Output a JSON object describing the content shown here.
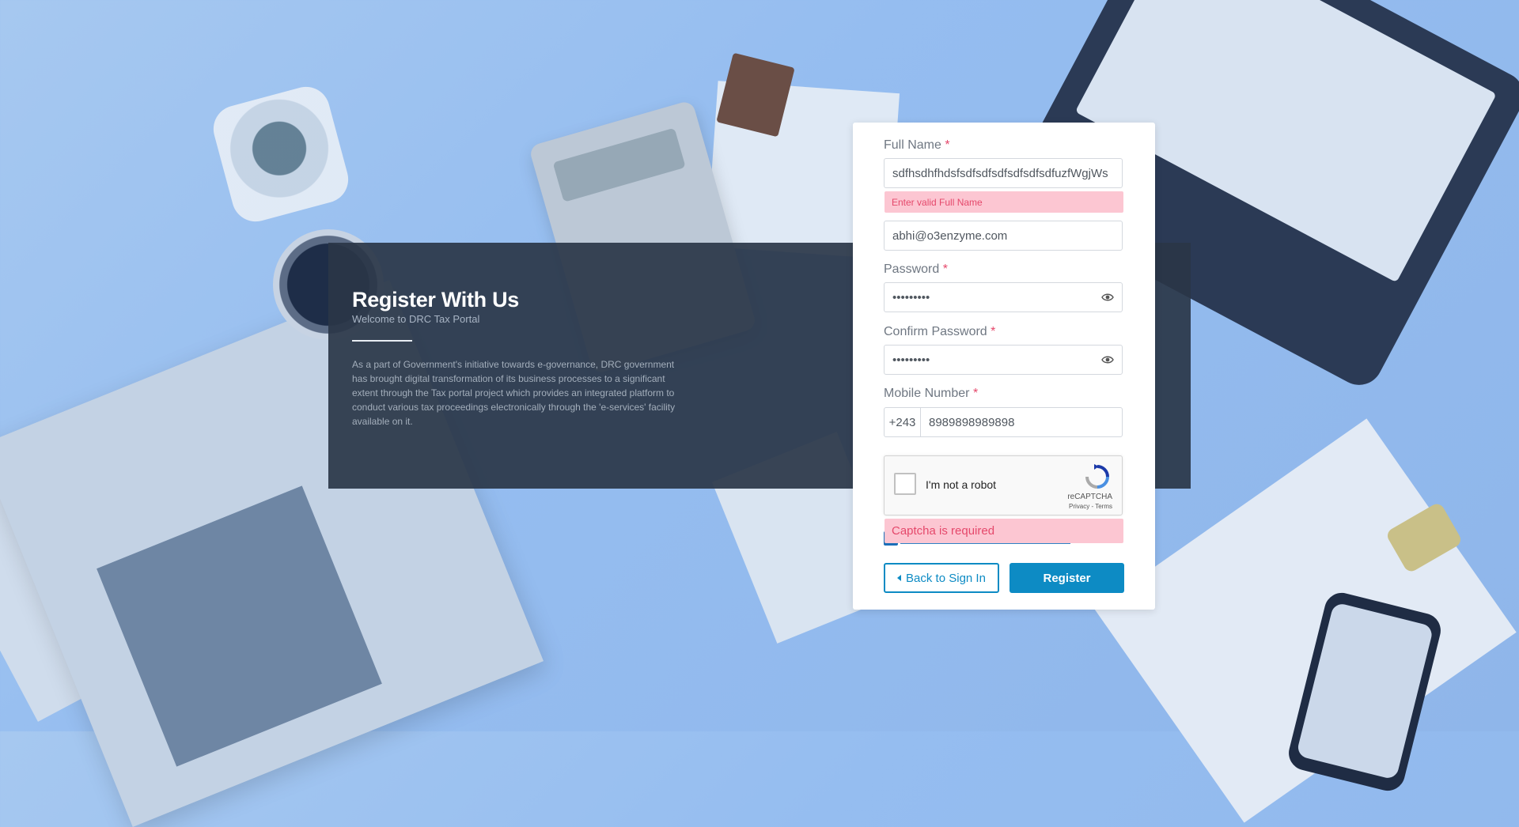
{
  "info": {
    "title": "Register With Us",
    "subtitle": "Welcome to DRC Tax Portal",
    "description": "As a part of Government's initiative towards e-governance, DRC government has brought digital transformation of its business processes to a significant extent through the Tax portal project which provides an integrated platform to conduct various tax proceedings electronically through the 'e-services' facility available on it."
  },
  "form": {
    "full_name": {
      "label": "Full Name",
      "required_mark": "*",
      "value": "sdfhsdhfhdsfsdfsdfsdfsdfsdfsdfuzfWgjWs",
      "error": "Enter valid Full Name"
    },
    "email": {
      "value": "abhi@o3enzyme.com"
    },
    "password": {
      "label": "Password",
      "required_mark": "*",
      "value": "•••••••••"
    },
    "confirm_password": {
      "label": "Confirm Password",
      "required_mark": "*",
      "value": "•••••••••"
    },
    "mobile": {
      "label": "Mobile Number",
      "required_mark": "*",
      "prefix": "+243",
      "value": "8989898989898"
    },
    "captcha": {
      "label": "I'm not a robot",
      "brand": "reCAPTCHA",
      "links": "Privacy - Terms",
      "error": "Captcha is required"
    },
    "buttons": {
      "back": "Back to Sign In",
      "register": "Register"
    }
  },
  "colors": {
    "accent": "#0d8bc4",
    "error_text": "#e5486b",
    "error_bg": "#fcc6d2",
    "panel": "#2a3648"
  }
}
